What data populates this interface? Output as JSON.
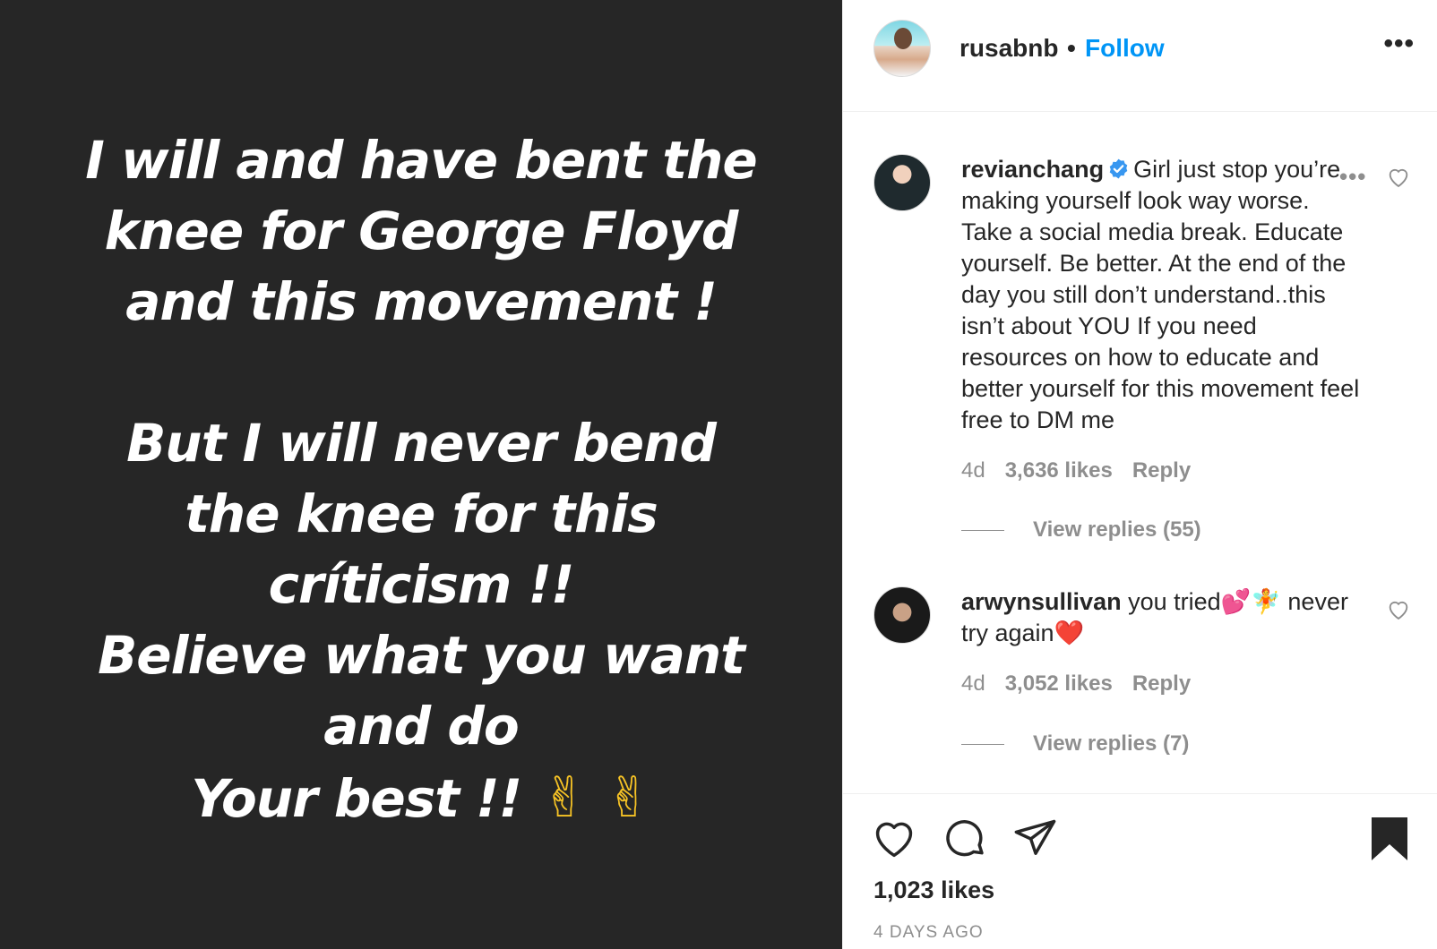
{
  "story": {
    "lines": [
      "I will and have bent the",
      "knee for George Floyd",
      "and this movement !",
      "",
      "But I will never bend",
      "the knee for this",
      "críticism !!",
      "Believe what you want",
      "and do",
      "Your best !!"
    ],
    "emoji": "✌ ✌"
  },
  "header": {
    "username": "rusabnb",
    "separator": "•",
    "follow_label": "Follow",
    "more_label": "•••"
  },
  "comments": [
    {
      "username": "revianchang",
      "verified": true,
      "text": "Girl just stop you’re making yourself look way worse. Take a social media break. Educate yourself. Be better. At the end of the day you still don’t understand..this isn’t about YOU If you need resources on how to educate and better yourself for this movement feel free to DM me",
      "age": "4d",
      "likes": "3,636 likes",
      "reply_label": "Reply",
      "view_replies": "View replies (55)"
    },
    {
      "username": "arwynsullivan",
      "verified": false,
      "text_before": "you tried",
      "emoji_1": "💕",
      "emoji_2": "🧚",
      "text_after": " never try again",
      "emoji_3": "❤️",
      "age": "4d",
      "likes": "3,052 likes",
      "reply_label": "Reply",
      "view_replies": "View replies (7)"
    }
  ],
  "actions": {
    "likes_count": "1,023 likes",
    "time": "4 DAYS AGO"
  },
  "colors": {
    "accent": "#0095f6",
    "story_bg": "#262626",
    "muted": "#8e8e8e",
    "verified": "#3897f0"
  }
}
